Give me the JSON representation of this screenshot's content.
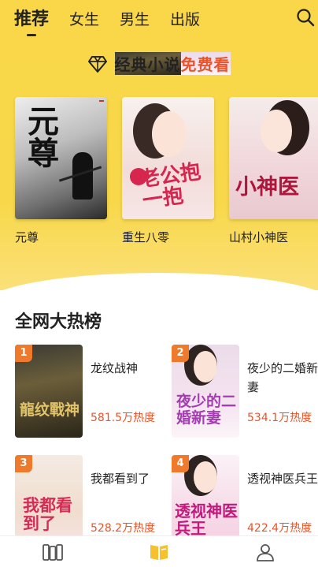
{
  "header": {
    "tabs": [
      {
        "label": "推荐",
        "active": true
      },
      {
        "label": "女生",
        "active": false
      },
      {
        "label": "男生",
        "active": false
      },
      {
        "label": "出版",
        "active": false
      }
    ],
    "search_icon": "search-icon"
  },
  "banner": {
    "icon": "diamond-icon",
    "text_main": "经典小说",
    "text_highlight": "免费看"
  },
  "featured": [
    {
      "title": "元尊",
      "cover_text": "元尊"
    },
    {
      "title": "重生八零",
      "cover_text": "老公抱一抱"
    },
    {
      "title": "山村小神医",
      "cover_text": "小神医"
    }
  ],
  "hot_list": {
    "title": "全网大热榜",
    "items": [
      {
        "rank": "1",
        "name": "龙纹战神",
        "heat": "581.5万热度",
        "cover_text": "龍纹戰神"
      },
      {
        "rank": "2",
        "name": "夜少的二婚新妻",
        "heat": "534.1万热度",
        "cover_text": "夜少的二婚新妻"
      },
      {
        "rank": "3",
        "name": "我都看到了",
        "heat": "528.2万热度",
        "cover_text": "我都看到了"
      },
      {
        "rank": "4",
        "name": "透视神医兵王",
        "heat": "422.4万热度",
        "cover_text": "透视神医兵王"
      }
    ]
  },
  "bottom_nav": [
    "bookshelf-icon",
    "bookstore-icon",
    "profile-icon"
  ],
  "colors": {
    "accent_yellow": "#f9d748",
    "highlight_red": "#e9542a",
    "rank_orange": "#f07a2c"
  }
}
